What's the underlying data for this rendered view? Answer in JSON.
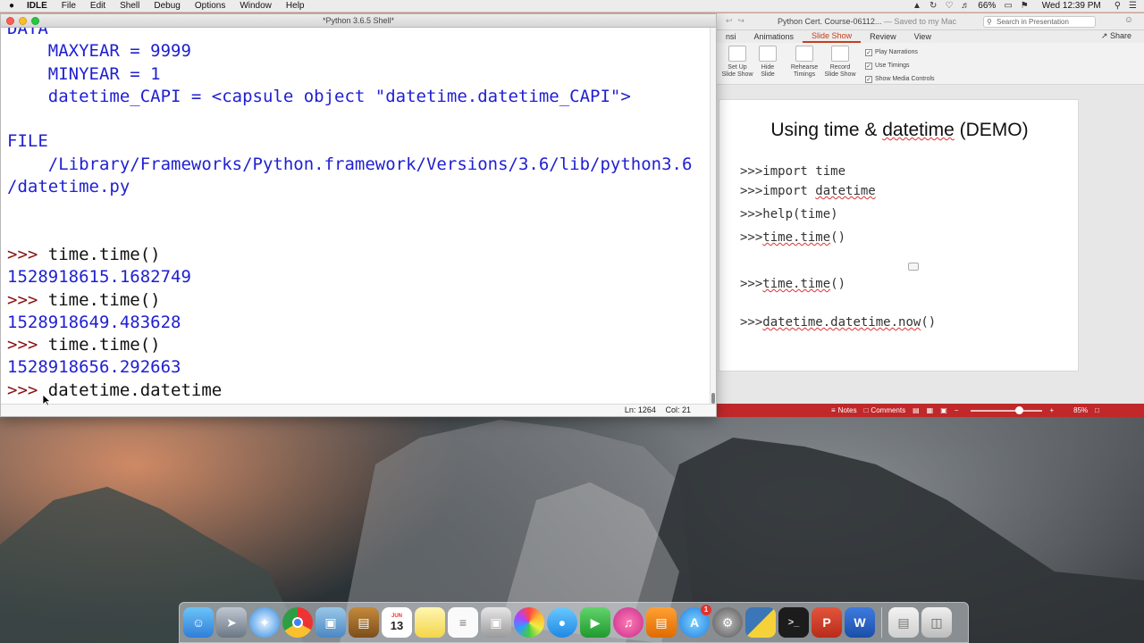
{
  "menubar": {
    "app_name": "IDLE",
    "items": [
      "File",
      "Edit",
      "Shell",
      "Debug",
      "Options",
      "Window",
      "Help"
    ],
    "battery": "66%",
    "clock": "Wed 12:39 PM"
  },
  "idle": {
    "window_title": "*Python 3.6.5 Shell*",
    "lines": [
      {
        "kind": "out",
        "text": "DATA"
      },
      {
        "kind": "out",
        "text": "    MAXYEAR = 9999"
      },
      {
        "kind": "out",
        "text": "    MINYEAR = 1"
      },
      {
        "kind": "out",
        "text": "    datetime_CAPI = <capsule object \"datetime.datetime_CAPI\">"
      },
      {
        "kind": "blank",
        "text": ""
      },
      {
        "kind": "out",
        "text": "FILE"
      },
      {
        "kind": "out",
        "text": "    /Library/Frameworks/Python.framework/Versions/3.6/lib/python3.6"
      },
      {
        "kind": "out",
        "text": "/datetime.py"
      },
      {
        "kind": "blank",
        "text": ""
      },
      {
        "kind": "blank",
        "text": ""
      },
      {
        "kind": "in",
        "prompt": ">>> ",
        "text": "time.time()"
      },
      {
        "kind": "out",
        "text": "1528918615.1682749"
      },
      {
        "kind": "in",
        "prompt": ">>> ",
        "text": "time.time()"
      },
      {
        "kind": "out",
        "text": "1528918649.483628"
      },
      {
        "kind": "in",
        "prompt": ">>> ",
        "text": "time.time()"
      },
      {
        "kind": "out",
        "text": "1528918656.292663"
      },
      {
        "kind": "in",
        "prompt": ">>> ",
        "text": "datetime.datetime"
      }
    ],
    "status_ln": "Ln: 1264",
    "status_col": "Col: 21"
  },
  "ppt": {
    "doc_title": "Python Cert. Course-06112...",
    "saved_text": "— Saved to my Mac",
    "search_placeholder": "Search in Presentation",
    "tabs": [
      "nsi",
      "Animations",
      "Slide Show",
      "Review",
      "View"
    ],
    "active_tab": "Slide Show",
    "share_label": "Share",
    "ribbon": {
      "set_up": "Set Up\nSlide Show",
      "hide": "Hide\nSlide",
      "rehearse": "Rehearse\nTimings",
      "record": "Record\nSlide Show",
      "checks": [
        "Play Narrations",
        "Use Timings",
        "Show Media Controls"
      ]
    },
    "slide": {
      "title_a": "Using time & ",
      "title_b": "datetime",
      "title_c": " (DEMO)",
      "lines": [
        {
          "prefix": ">>>import time",
          "sq": ""
        },
        {
          "prefix": ">>>import ",
          "sq": "datetime"
        },
        {
          "prefix": ">>>help(time)",
          "sq": ""
        },
        {
          "prefix": ">>>",
          "sq": "time.time",
          "suffix": "()"
        },
        {
          "prefix": ">>>",
          "sq": "time.time",
          "suffix": "()"
        },
        {
          "prefix": ">>>",
          "sq": "datetime.datetime.now",
          "suffix": "()"
        }
      ]
    },
    "statusbar": {
      "notes": "Notes",
      "comments": "Comments",
      "zoom": "85%"
    }
  },
  "dock": {
    "calendar_day": "13",
    "appstore_badge": "1",
    "icons": [
      "finder-icon",
      "launchpad-icon",
      "safari-icon",
      "chrome-icon",
      "preview-icon",
      "books-icon",
      "calendar-icon",
      "notes-icon",
      "reminders-icon",
      "photo-booth-icon",
      "photos-icon",
      "messages-icon",
      "facetime-icon",
      "itunes-icon",
      "ibooks-icon",
      "app-store-icon",
      "system-preferences-icon",
      "python-launcher-icon",
      "terminal-icon",
      "powerpoint-icon",
      "word-icon",
      "downloads-stack-icon",
      "trash-icon"
    ]
  }
}
